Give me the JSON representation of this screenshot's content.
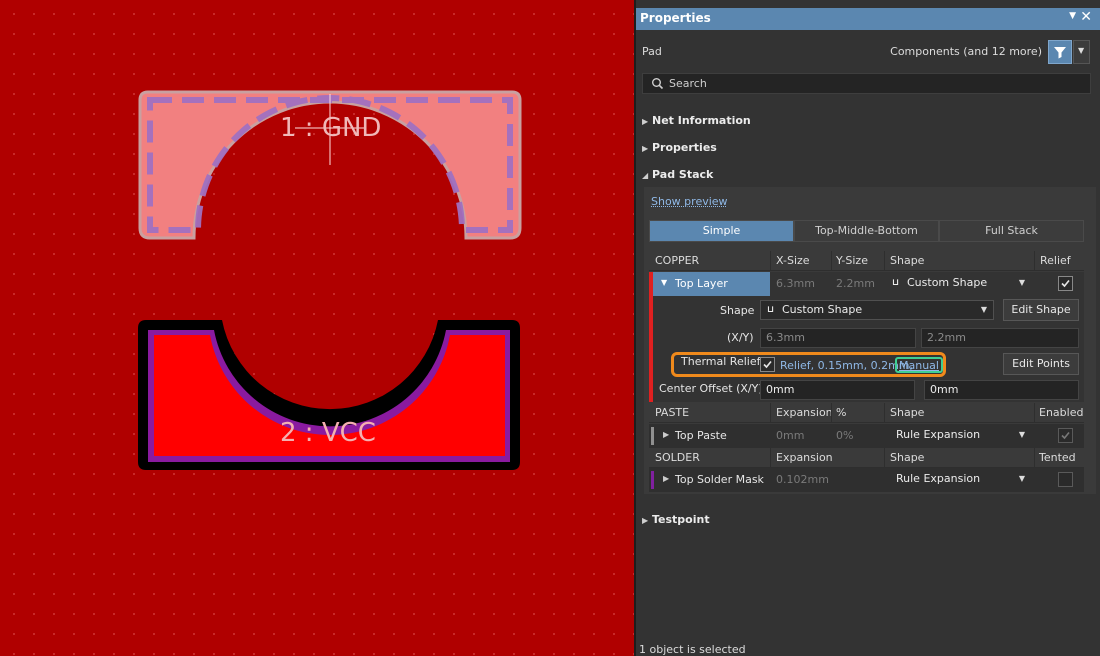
{
  "canvas": {
    "pads": [
      {
        "label": "1 : GND",
        "fill": "#f28080",
        "outline": "#a070b0"
      },
      {
        "label": "2 : VCC",
        "fill": "#ff0000",
        "outline": "#8020a0"
      }
    ],
    "background_color": "#b00000"
  },
  "panel": {
    "title": "Properties",
    "object_kind": "Pad",
    "filter_label": "Components (and 12 more)",
    "search_placeholder": "Search",
    "sections": {
      "net_information": "Net Information",
      "properties": "Properties",
      "pad_stack": "Pad Stack",
      "testpoint": "Testpoint"
    },
    "show_preview": "Show preview",
    "tabs": [
      "Simple",
      "Top-Middle-Bottom",
      "Full Stack"
    ],
    "copper": {
      "headers": [
        "COPPER",
        "X-Size",
        "Y-Size",
        "Shape",
        "Relief"
      ],
      "layer": "Top Layer",
      "x_size": "6.3mm",
      "y_size": "2.2mm",
      "shape": "Custom Shape",
      "relief_checked": true,
      "shape_label": "Shape",
      "shape_value": "Custom Shape",
      "edit_shape": "Edit Shape",
      "xy_label": "(X/Y)",
      "x_value": "6.3mm",
      "y_value": "2.2mm",
      "thermal_label": "Thermal Relief",
      "thermal_text": "Relief, 0.15mm, 0.2mm,",
      "thermal_manual": "Manual",
      "edit_points": "Edit Points",
      "center_offset_label": "Center Offset (X/Y)",
      "offset_x": "0mm",
      "offset_y": "0mm"
    },
    "paste": {
      "headers": [
        "PASTE",
        "Expansion",
        "%",
        "Shape",
        "Enabled"
      ],
      "layer": "Top Paste",
      "expansion": "0mm",
      "percent": "0%",
      "shape": "Rule Expansion",
      "enabled": true
    },
    "solder": {
      "headers": [
        "SOLDER",
        "Expansion",
        "Shape",
        "Tented"
      ],
      "layer": "Top Solder Mask",
      "expansion": "0.102mm",
      "shape": "Rule Expansion",
      "tented": false
    },
    "status": "1 object is selected",
    "colors": {
      "accent": "#5b87b0",
      "highlight_orange": "#f08a1c",
      "highlight_green": "#3fcf94",
      "top_layer": "#e02020",
      "solder_layer": "#8020a0"
    }
  }
}
